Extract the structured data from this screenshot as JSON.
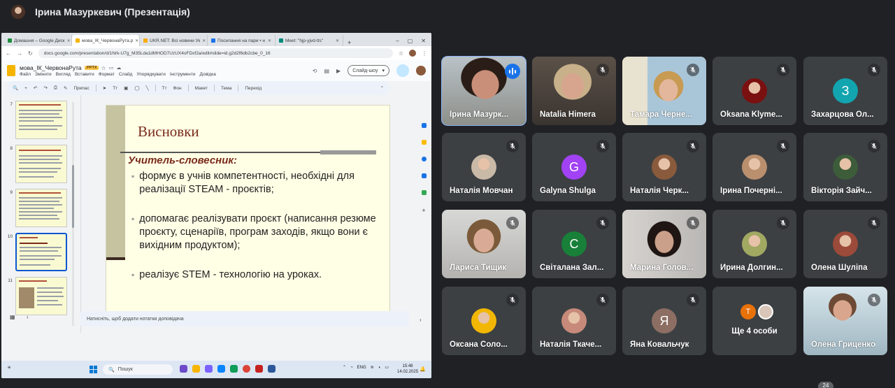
{
  "presenter": {
    "title": "Ірина Мазуркевич (Презентація)"
  },
  "browser": {
    "tabs": [
      {
        "label": "Домашня – Google Диск",
        "color": "#1e8e3e",
        "active": false
      },
      {
        "label": "мова_ІК_ЧервонаРута.p",
        "color": "#f4b400",
        "active": true
      },
      {
        "label": "UKR.NET: Всі новини Ук",
        "color": "#f9ab00",
        "active": false
      },
      {
        "label": "Посилання на пари • н",
        "color": "#1a73e8",
        "active": false
      },
      {
        "label": "Meet: \"hjp-yjvd-tts\"",
        "color": "#00897b",
        "active": false
      }
    ],
    "url": "docs.google.com/presentation/d/1Nrk-U7g_M35Lda1dMHOD7UzUX4oFDxf2a/edit#slide=id.g2d2f6db2cbe_0_16"
  },
  "doc": {
    "title": "мова_ІК_ЧервонаРута",
    "badge": ".PPTX",
    "menu": [
      "Файл",
      "Змінити",
      "Вигляд",
      "Вставити",
      "Формат",
      "Слайд",
      "Упорядкувати",
      "Інструменти",
      "Довідка"
    ],
    "slideshow_label": "Слайд-шоу",
    "toolbar": [
      "Припас",
      "Фон",
      "Макет",
      "Тема",
      "Перехід"
    ]
  },
  "filmstrip": {
    "numbers": [
      "7",
      "8",
      "9",
      "10",
      "11"
    ],
    "selected": "10"
  },
  "slide": {
    "title": "Висновки",
    "subtitle": "Учитель-словесник:",
    "bullets": [
      "формує в учнів компетентності, необхідні для реалізації STEAM - проєктів;",
      "допомагає реалізувати проєкт (написання резюме проєкту, сценаріїв, програм заходів, якщо вони є вихідним продуктом);",
      "реалізує STEM - технологію на уроках."
    ]
  },
  "notes_placeholder": "Натисніть, щоб додати нотатки доповідача",
  "taskbar": {
    "search_label": "Пошук",
    "lang": "ENG",
    "time": "15:48",
    "date": "14.02.2025"
  },
  "participants": [
    {
      "name": "Ірина Мазурк...",
      "kind": "photo",
      "speaking": true
    },
    {
      "name": "Natalia Himera",
      "kind": "photo",
      "muted": true
    },
    {
      "name": "Тамара Черне...",
      "kind": "photo",
      "muted": true
    },
    {
      "name": "Oksana Klyme...",
      "kind": "avatar",
      "muted": true,
      "color": "#7a1010"
    },
    {
      "name": "Захарцова Ол...",
      "kind": "letter",
      "letter": "З",
      "color": "#12a4af",
      "muted": true
    },
    {
      "name": "Наталія Мовчан",
      "kind": "avatar",
      "muted": true,
      "color": "#c9b9a7"
    },
    {
      "name": "Galyna Shulga",
      "kind": "letter",
      "letter": "G",
      "color": "#a142f4",
      "muted": true
    },
    {
      "name": "Наталія Черк...",
      "kind": "avatar",
      "muted": true,
      "color": "#8a5a3c"
    },
    {
      "name": "Ірина Почерні...",
      "kind": "avatar",
      "muted": true,
      "color": "#b98f6e"
    },
    {
      "name": "Вікторія Зайч...",
      "kind": "avatar",
      "muted": true,
      "color": "#3d5c3a"
    },
    {
      "name": "Лариса Тищик",
      "kind": "photo",
      "muted": true
    },
    {
      "name": "Світалана Зал...",
      "kind": "letter",
      "letter": "С",
      "color": "#188038",
      "muted": true
    },
    {
      "name": "Марина Голов...",
      "kind": "photo",
      "muted": true
    },
    {
      "name": "Ирина Долгин...",
      "kind": "avatar",
      "muted": true,
      "color": "#a0a862"
    },
    {
      "name": "Олена Шуліпа",
      "kind": "avatar",
      "muted": true,
      "color": "#9c4a3a"
    },
    {
      "name": "Оксана Соло...",
      "kind": "avatar",
      "muted": true,
      "color": "#f2b705"
    },
    {
      "name": "Наталія Ткаче...",
      "kind": "avatar",
      "muted": true,
      "color": "#c78a7a"
    },
    {
      "name": "Яна Ковальчук",
      "kind": "letter",
      "letter": "Я",
      "color": "#8d6e63",
      "muted": true
    },
    {
      "name": "Ще 4 особи",
      "kind": "more",
      "letter": "T"
    },
    {
      "name": "Олена Гриценко",
      "kind": "photo",
      "muted": true
    }
  ],
  "participant_count": "24"
}
